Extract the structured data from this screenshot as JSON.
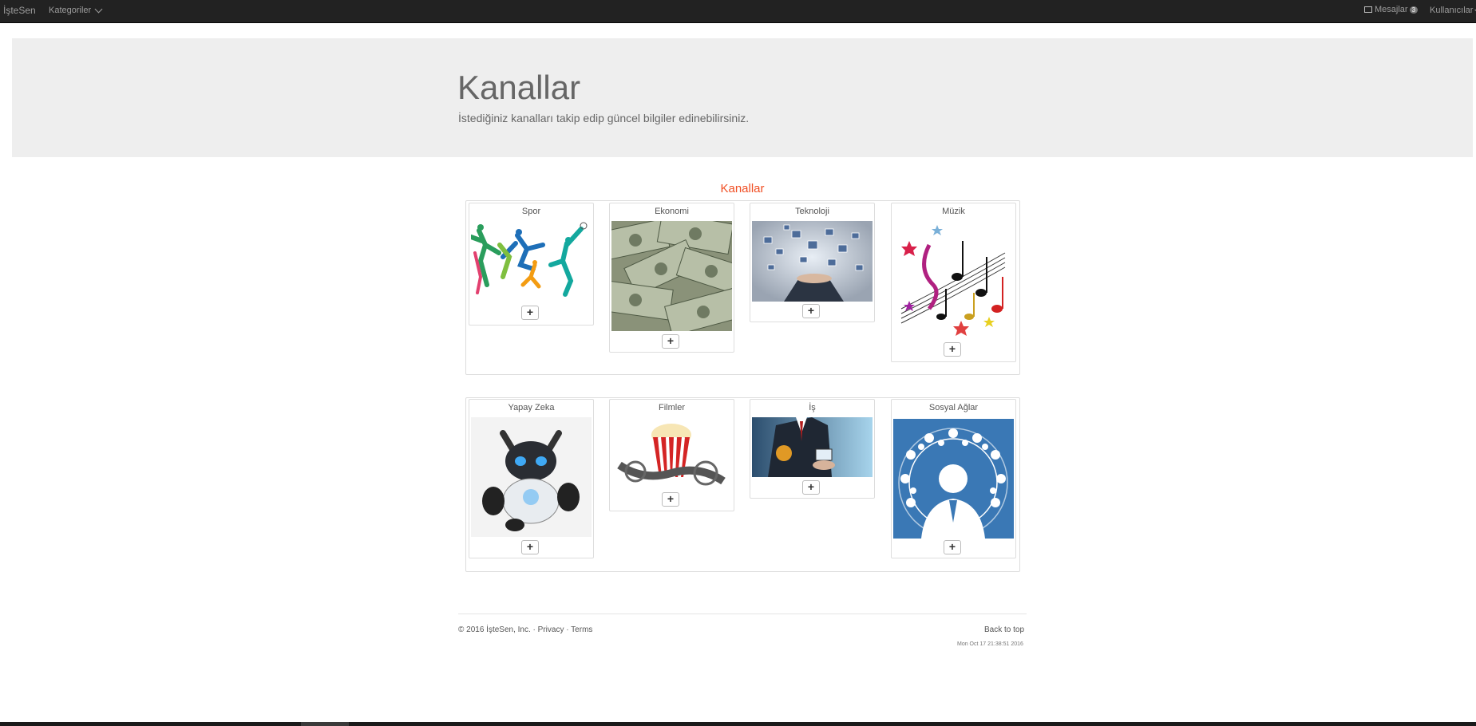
{
  "navbar": {
    "brand": "İşteSen",
    "categories": "Kategoriler",
    "messages": "Mesajlar",
    "messages_count": "3",
    "users": "Kullanıcılar"
  },
  "jumbotron": {
    "title": "Kanallar",
    "subtitle": "İstediğiniz kanalları takip edip güncel bilgiler edinebilirsiniz."
  },
  "section_title": "Kanallar",
  "channels": [
    {
      "name": "Spor",
      "image": "athletes-illustration"
    },
    {
      "name": "Ekonomi",
      "image": "dollar-bills-photo"
    },
    {
      "name": "Teknoloji",
      "image": "hand-with-floating-screens-photo"
    },
    {
      "name": "Müzik",
      "image": "music-notes-illustration"
    },
    {
      "name": "Yapay Zeka",
      "image": "robot-dog-photo"
    },
    {
      "name": "Filmler",
      "image": "popcorn-film-reel-photo"
    },
    {
      "name": "İş",
      "image": "businessman-photo"
    },
    {
      "name": "Sosyal Ağlar",
      "image": "social-network-person-icon"
    }
  ],
  "add_label": "+",
  "footer": {
    "copyright": "© 2016 İşteSen, Inc. · ",
    "privacy": "Privacy",
    "sep": " · ",
    "terms": "Terms",
    "back_to_top": "Back to top",
    "date": "Mon Oct 17 21:38:51 2016"
  }
}
